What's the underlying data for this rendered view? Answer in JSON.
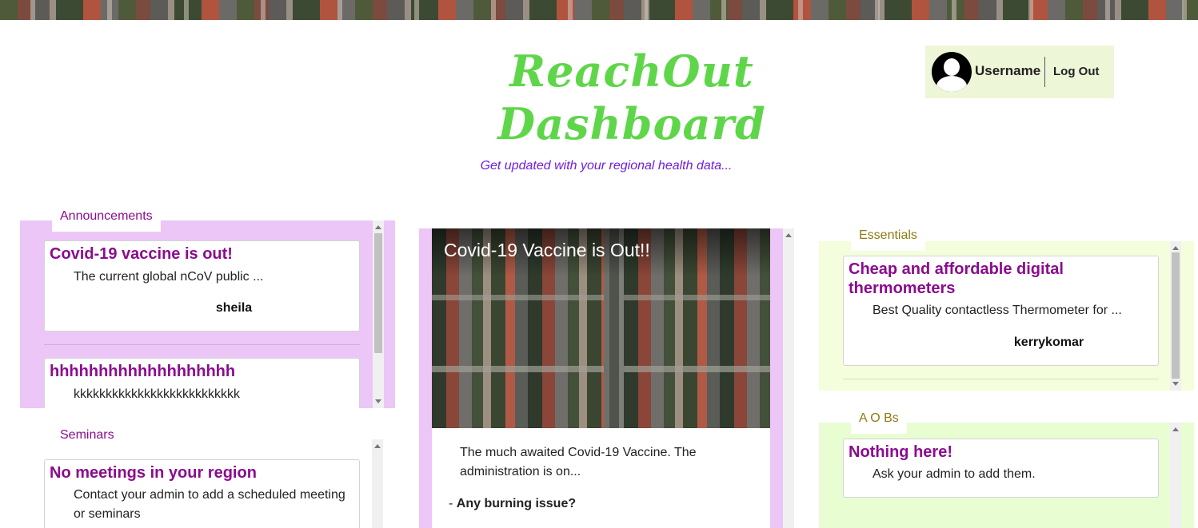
{
  "header": {
    "brand_line1": "ReachOut",
    "brand_line2": "Dashboard",
    "subtitle": "Get updated with your regional health data..."
  },
  "user": {
    "name": "Username",
    "logout_label": "Log Out"
  },
  "announcements": {
    "label": "Announcements",
    "items": [
      {
        "title": "Covid-19 vaccine is out!",
        "body": "The current global nCoV public ...",
        "author": "sheila"
      },
      {
        "title": "hhhhhhhhhhhhhhhhhhh",
        "body": "kkkkkkkkkkkkkkkkkkkkkkkkkk"
      }
    ]
  },
  "seminars": {
    "label": "Seminars",
    "items": [
      {
        "title": "No meetings in your region",
        "body": "Contact your admin to add a scheduled meeting or seminars"
      }
    ]
  },
  "feature": {
    "title": "Covid-19 Vaccine is Out!!",
    "body": "The much awaited Covid-19 Vaccine. The administration is on...",
    "issue_prefix": "- ",
    "issue_label": "Any burning issue?"
  },
  "essentials": {
    "label": "Essentials",
    "items": [
      {
        "title": "Cheap and affordable digital thermometers",
        "body": "Best Quality contactless Thermometer for ...",
        "author": "kerrykomar"
      }
    ]
  },
  "aobs": {
    "label": "A O Bs",
    "items": [
      {
        "title": "Nothing here!",
        "body": "Ask your admin to add them."
      }
    ]
  },
  "colors": {
    "brand": "#5fd64a",
    "subtitle": "#6e1ee0",
    "card_title": "#8b0b8f",
    "announcements_bg": "#ecc6f7",
    "essentials_bg": "#f4fddc",
    "aobs_bg": "#e9fdd3",
    "essentials_label": "#8e7a12"
  },
  "icons": {
    "avatar": "user-avatar-icon"
  }
}
